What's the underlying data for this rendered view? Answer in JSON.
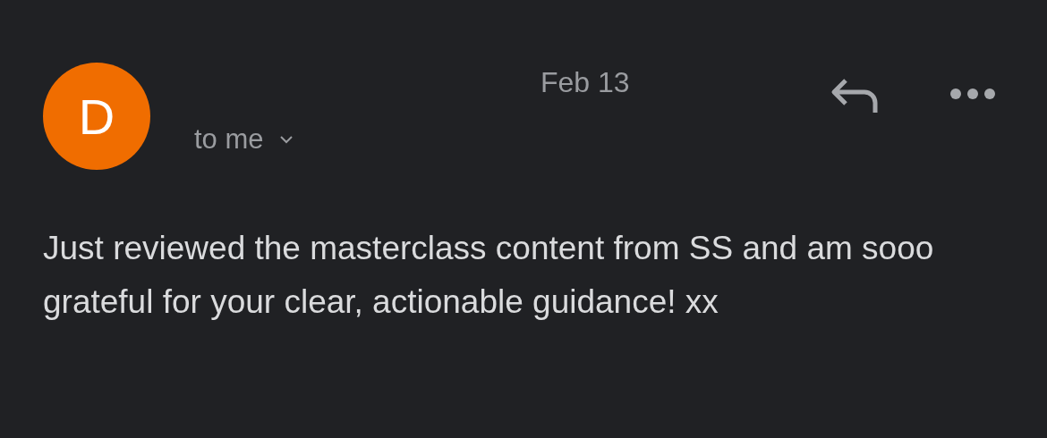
{
  "sender": {
    "initial": "D",
    "color": "#f06d00"
  },
  "date": "Feb 13",
  "recipient": "to me",
  "body": "Just reviewed the masterclass content from SS and am sooo grateful for your clear, actionable guidance! xx"
}
